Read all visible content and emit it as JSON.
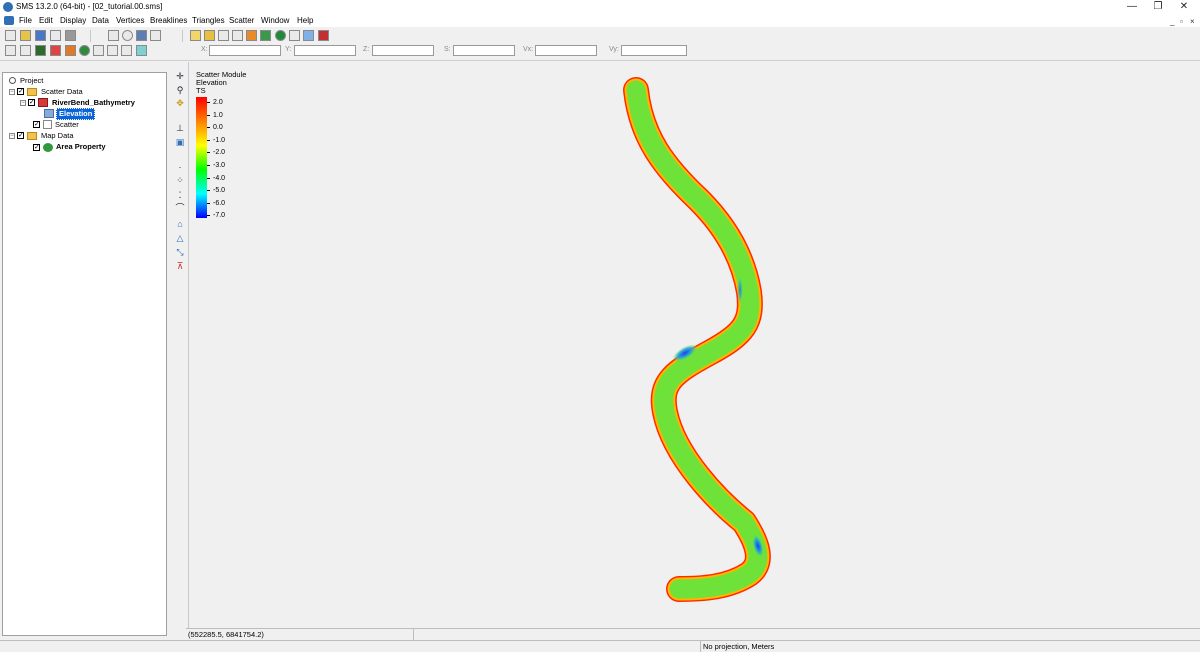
{
  "window": {
    "title": "SMS 13.2.0 (64-bit) - [02_tutorial.00.sms]",
    "controls": [
      "—",
      "❐",
      "✕"
    ],
    "mdi_controls": [
      "_",
      "▫",
      "×"
    ]
  },
  "menu": [
    "File",
    "Edit",
    "Display",
    "Data",
    "Vertices",
    "Breaklines",
    "Triangles",
    "Scatter",
    "Window",
    "Help"
  ],
  "coords": {
    "labels": [
      "X:",
      "Y:",
      "Z:",
      "S:",
      "Vx:",
      "Vy:"
    ]
  },
  "tree": {
    "project": "Project",
    "scatter_data": "Scatter Data",
    "riverbend": "RiverBend_Bathymetry",
    "elevation": "Elevation",
    "scatter": "Scatter",
    "map_data": "Map Data",
    "area_property": "Area Property"
  },
  "legend": {
    "module": "Scatter Module",
    "dataset": "Elevation",
    "ts": "TS",
    "ticks": [
      "2.0",
      "1.0",
      "0.0",
      "-1.0",
      "-2.0",
      "-3.0",
      "-4.0",
      "-5.0",
      "-6.0",
      "-7.0"
    ],
    "colors": [
      "#ff0000",
      "#ff8000",
      "#ffff00",
      "#00ff00",
      "#00ffff",
      "#0000ff"
    ]
  },
  "status": {
    "cursor": "(552285.5, 6841754.2)",
    "projection": "No projection, Meters"
  },
  "colors": {
    "river_fill": "#6fe23a",
    "river_edge": "#ff2a00",
    "river_bank": "#ffb400",
    "deep": "#2a66ff",
    "mid": "#18c6a8",
    "selection": "#0a64d8"
  }
}
